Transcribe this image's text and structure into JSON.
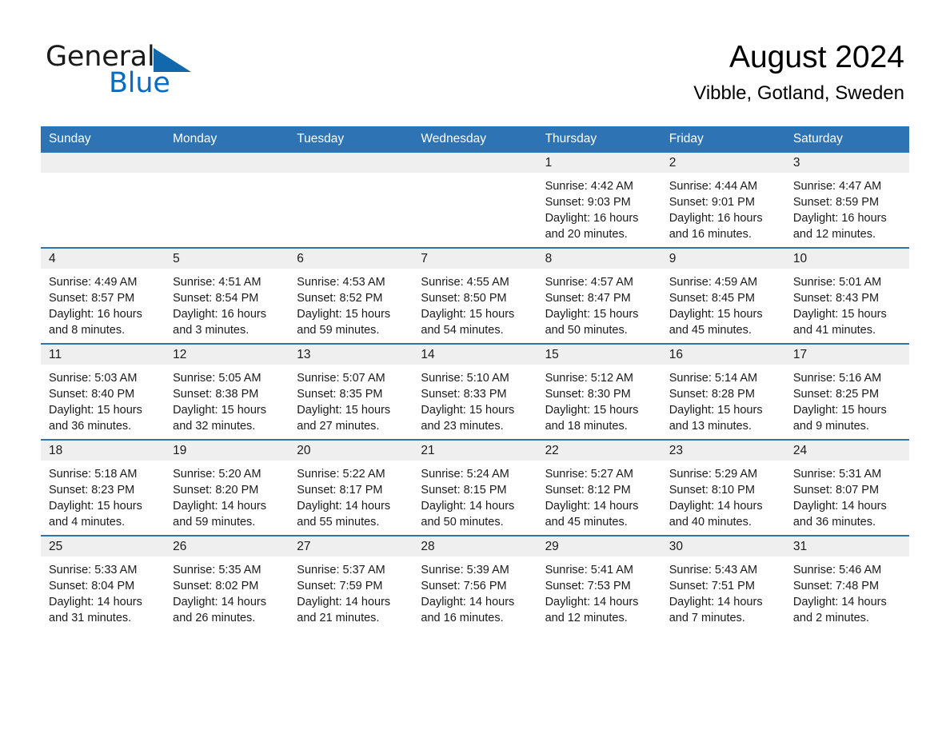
{
  "logo": {
    "word1": "General",
    "word2": "Blue",
    "triangle_color": "#1268ad"
  },
  "header": {
    "title": "August 2024",
    "location": "Vibble, Gotland, Sweden"
  },
  "theme": {
    "header_blue": "#2E74B5",
    "band_gray": "#efefef",
    "text": "#1a1a1a"
  },
  "weekday_headers": [
    "Sunday",
    "Monday",
    "Tuesday",
    "Wednesday",
    "Thursday",
    "Friday",
    "Saturday"
  ],
  "weeks": [
    [
      {
        "day": "",
        "empty": true
      },
      {
        "day": "",
        "empty": true
      },
      {
        "day": "",
        "empty": true
      },
      {
        "day": "",
        "empty": true
      },
      {
        "day": "1",
        "sunrise": "Sunrise: 4:42 AM",
        "sunset": "Sunset: 9:03 PM",
        "daylight": "Daylight: 16 hours and 20 minutes."
      },
      {
        "day": "2",
        "sunrise": "Sunrise: 4:44 AM",
        "sunset": "Sunset: 9:01 PM",
        "daylight": "Daylight: 16 hours and 16 minutes."
      },
      {
        "day": "3",
        "sunrise": "Sunrise: 4:47 AM",
        "sunset": "Sunset: 8:59 PM",
        "daylight": "Daylight: 16 hours and 12 minutes."
      }
    ],
    [
      {
        "day": "4",
        "sunrise": "Sunrise: 4:49 AM",
        "sunset": "Sunset: 8:57 PM",
        "daylight": "Daylight: 16 hours and 8 minutes."
      },
      {
        "day": "5",
        "sunrise": "Sunrise: 4:51 AM",
        "sunset": "Sunset: 8:54 PM",
        "daylight": "Daylight: 16 hours and 3 minutes."
      },
      {
        "day": "6",
        "sunrise": "Sunrise: 4:53 AM",
        "sunset": "Sunset: 8:52 PM",
        "daylight": "Daylight: 15 hours and 59 minutes."
      },
      {
        "day": "7",
        "sunrise": "Sunrise: 4:55 AM",
        "sunset": "Sunset: 8:50 PM",
        "daylight": "Daylight: 15 hours and 54 minutes."
      },
      {
        "day": "8",
        "sunrise": "Sunrise: 4:57 AM",
        "sunset": "Sunset: 8:47 PM",
        "daylight": "Daylight: 15 hours and 50 minutes."
      },
      {
        "day": "9",
        "sunrise": "Sunrise: 4:59 AM",
        "sunset": "Sunset: 8:45 PM",
        "daylight": "Daylight: 15 hours and 45 minutes."
      },
      {
        "day": "10",
        "sunrise": "Sunrise: 5:01 AM",
        "sunset": "Sunset: 8:43 PM",
        "daylight": "Daylight: 15 hours and 41 minutes."
      }
    ],
    [
      {
        "day": "11",
        "sunrise": "Sunrise: 5:03 AM",
        "sunset": "Sunset: 8:40 PM",
        "daylight": "Daylight: 15 hours and 36 minutes."
      },
      {
        "day": "12",
        "sunrise": "Sunrise: 5:05 AM",
        "sunset": "Sunset: 8:38 PM",
        "daylight": "Daylight: 15 hours and 32 minutes."
      },
      {
        "day": "13",
        "sunrise": "Sunrise: 5:07 AM",
        "sunset": "Sunset: 8:35 PM",
        "daylight": "Daylight: 15 hours and 27 minutes."
      },
      {
        "day": "14",
        "sunrise": "Sunrise: 5:10 AM",
        "sunset": "Sunset: 8:33 PM",
        "daylight": "Daylight: 15 hours and 23 minutes."
      },
      {
        "day": "15",
        "sunrise": "Sunrise: 5:12 AM",
        "sunset": "Sunset: 8:30 PM",
        "daylight": "Daylight: 15 hours and 18 minutes."
      },
      {
        "day": "16",
        "sunrise": "Sunrise: 5:14 AM",
        "sunset": "Sunset: 8:28 PM",
        "daylight": "Daylight: 15 hours and 13 minutes."
      },
      {
        "day": "17",
        "sunrise": "Sunrise: 5:16 AM",
        "sunset": "Sunset: 8:25 PM",
        "daylight": "Daylight: 15 hours and 9 minutes."
      }
    ],
    [
      {
        "day": "18",
        "sunrise": "Sunrise: 5:18 AM",
        "sunset": "Sunset: 8:23 PM",
        "daylight": "Daylight: 15 hours and 4 minutes."
      },
      {
        "day": "19",
        "sunrise": "Sunrise: 5:20 AM",
        "sunset": "Sunset: 8:20 PM",
        "daylight": "Daylight: 14 hours and 59 minutes."
      },
      {
        "day": "20",
        "sunrise": "Sunrise: 5:22 AM",
        "sunset": "Sunset: 8:17 PM",
        "daylight": "Daylight: 14 hours and 55 minutes."
      },
      {
        "day": "21",
        "sunrise": "Sunrise: 5:24 AM",
        "sunset": "Sunset: 8:15 PM",
        "daylight": "Daylight: 14 hours and 50 minutes."
      },
      {
        "day": "22",
        "sunrise": "Sunrise: 5:27 AM",
        "sunset": "Sunset: 8:12 PM",
        "daylight": "Daylight: 14 hours and 45 minutes."
      },
      {
        "day": "23",
        "sunrise": "Sunrise: 5:29 AM",
        "sunset": "Sunset: 8:10 PM",
        "daylight": "Daylight: 14 hours and 40 minutes."
      },
      {
        "day": "24",
        "sunrise": "Sunrise: 5:31 AM",
        "sunset": "Sunset: 8:07 PM",
        "daylight": "Daylight: 14 hours and 36 minutes."
      }
    ],
    [
      {
        "day": "25",
        "sunrise": "Sunrise: 5:33 AM",
        "sunset": "Sunset: 8:04 PM",
        "daylight": "Daylight: 14 hours and 31 minutes."
      },
      {
        "day": "26",
        "sunrise": "Sunrise: 5:35 AM",
        "sunset": "Sunset: 8:02 PM",
        "daylight": "Daylight: 14 hours and 26 minutes."
      },
      {
        "day": "27",
        "sunrise": "Sunrise: 5:37 AM",
        "sunset": "Sunset: 7:59 PM",
        "daylight": "Daylight: 14 hours and 21 minutes."
      },
      {
        "day": "28",
        "sunrise": "Sunrise: 5:39 AM",
        "sunset": "Sunset: 7:56 PM",
        "daylight": "Daylight: 14 hours and 16 minutes."
      },
      {
        "day": "29",
        "sunrise": "Sunrise: 5:41 AM",
        "sunset": "Sunset: 7:53 PM",
        "daylight": "Daylight: 14 hours and 12 minutes."
      },
      {
        "day": "30",
        "sunrise": "Sunrise: 5:43 AM",
        "sunset": "Sunset: 7:51 PM",
        "daylight": "Daylight: 14 hours and 7 minutes."
      },
      {
        "day": "31",
        "sunrise": "Sunrise: 5:46 AM",
        "sunset": "Sunset: 7:48 PM",
        "daylight": "Daylight: 14 hours and 2 minutes."
      }
    ]
  ]
}
